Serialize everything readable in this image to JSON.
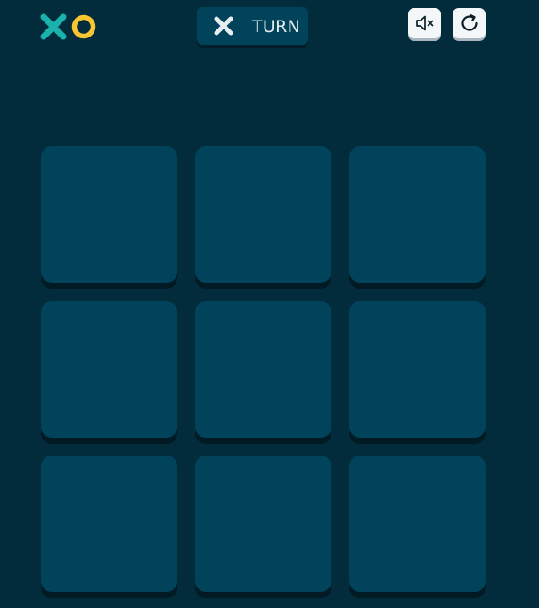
{
  "header": {
    "logo_icon": "xo-logo-icon",
    "turn": {
      "player_icon": "x-mark-icon",
      "label": "TURN"
    },
    "controls": {
      "mute_icon": "speaker-muted-icon",
      "restart_icon": "restart-icon"
    }
  },
  "board": {
    "cells": [
      "",
      "",
      "",
      "",
      "",
      "",
      "",
      "",
      ""
    ]
  },
  "colors": {
    "background": "#022c3c",
    "cell": "#00435a",
    "cell_shadow": "#011a24",
    "x_color": "#1bb1ad",
    "o_color": "#f6c531",
    "turn_x_color": "#e6eef1",
    "button_bg": "#f4f7f8"
  }
}
